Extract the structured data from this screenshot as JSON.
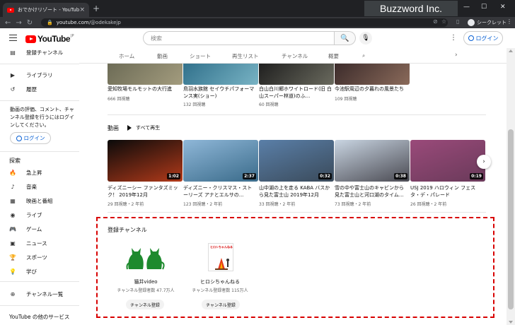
{
  "browser": {
    "tab_title": "おでかけリゾート - YouTube",
    "tab_close": "×",
    "new_tab": "+",
    "url_host": "youtube.com",
    "url_path": "/@odekakejp",
    "incognito_label": "シークレット",
    "brand": "Buzzword Inc."
  },
  "header": {
    "logo_word": "YouTube",
    "logo_region": "JP",
    "search_placeholder": "検索",
    "login_label": "ログイン"
  },
  "sidebar": {
    "top_items": [
      {
        "label": "登録チャンネル",
        "icon": "subscriptions-icon"
      },
      {
        "label": "ライブラリ",
        "icon": "library-icon"
      },
      {
        "label": "履歴",
        "icon": "history-icon"
      }
    ],
    "note": "動画の評価、コメント、チャンネル登録を行うにはログインしてください。",
    "login_label": "ログイン",
    "explore_heading": "探索",
    "explore_items": [
      {
        "label": "急上昇",
        "icon": "trending-icon"
      },
      {
        "label": "音楽",
        "icon": "music-icon"
      },
      {
        "label": "映画と番組",
        "icon": "movie-icon"
      },
      {
        "label": "ライブ",
        "icon": "live-icon"
      },
      {
        "label": "ゲーム",
        "icon": "gaming-icon"
      },
      {
        "label": "ニュース",
        "icon": "news-icon"
      },
      {
        "label": "スポーツ",
        "icon": "sports-icon"
      },
      {
        "label": "学び",
        "icon": "learning-icon"
      }
    ],
    "channel_list_label": "チャンネル一覧",
    "more_services": "YouTube の他のサービス"
  },
  "channel_tabs": [
    "ホーム",
    "動画",
    "ショート",
    "再生リスト",
    "チャンネル",
    "概要"
  ],
  "top_row": [
    {
      "title": "愛知牧場モルモットの大行進",
      "meta": "666 回視聴",
      "color1": "#6b6a55",
      "color2": "#a39c7e"
    },
    {
      "title": "鳥羽水族館 セイウチパフォーマンス実(ショー)",
      "meta": "132 回視聴",
      "color1": "#2f6f8a",
      "color2": "#78b3c4"
    },
    {
      "title": "白山白川郷ホワイトロード(旧 白山スーパー林道)のふ...",
      "meta": "60 回視聴",
      "color1": "#1d1d1d",
      "color2": "#6a6a5e"
    },
    {
      "title": "今池駅周辺の夕暮れの風景たち",
      "meta": "109 回視聴",
      "color1": "#3a2a2a",
      "color2": "#8a6a5a"
    }
  ],
  "videos_section": {
    "title": "動画",
    "play_all": "すべて再生",
    "items": [
      {
        "title": "ディズニーシー ファンタズミック！ 2019年12月",
        "meta": "29 回視聴・2 年前",
        "duration": "1:02",
        "color1": "#0a0a0a",
        "color2": "#b23a1a"
      },
      {
        "title": "ディズニー・クリスマス・ストーリーズ アナとエルサの...",
        "meta": "123 回視聴・2 年前",
        "duration": "2:37",
        "color1": "#8fb7d8",
        "color2": "#3a6b8a"
      },
      {
        "title": "山中湖の上を走る KABA バスから見た富士山 2019年12月",
        "meta": "33 回視聴・2 年前",
        "duration": "0:32",
        "color1": "#5a7fa8",
        "color2": "#3a4a5a"
      },
      {
        "title": "雪の中や富士山のキャビンから見た富士山と河口湖のタイム...",
        "meta": "73 回視聴・2 年前",
        "duration": "0:38",
        "color1": "#c9d5e2",
        "color2": "#4a4a52"
      },
      {
        "title": "USJ 2019 ハロウィン フェスタ・デ・パレード",
        "meta": "26 回視聴・2 年前",
        "duration": "0:19",
        "color1": "#9a4a7a",
        "color2": "#6a3a5a"
      }
    ]
  },
  "subscriptions_section": {
    "title": "登録チャンネル",
    "channels": [
      {
        "name": "猫井video",
        "subs": "チャンネル登録者数 47.7万人",
        "button": "チャンネル登録"
      },
      {
        "name": "ヒロシちゃんねる",
        "subs": "チャンネル登録者数 115万人",
        "button": "チャンネル登録",
        "logo_text": "ヒロシちゃんねる"
      }
    ]
  }
}
